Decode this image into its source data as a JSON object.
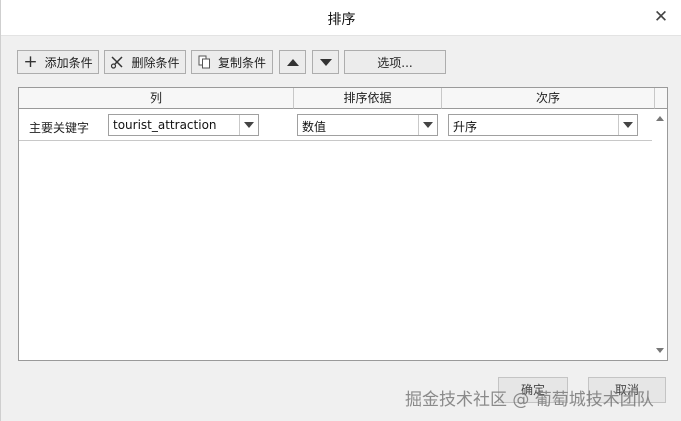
{
  "dialog": {
    "title": "排序",
    "close_glyph": "✕"
  },
  "toolbar": {
    "add_condition": "添加条件",
    "delete_condition": "删除条件",
    "copy_condition": "复制条件",
    "move_up_icon": "triangle-up-icon",
    "move_down_icon": "triangle-down-icon",
    "options": "选项..."
  },
  "grid": {
    "headers": {
      "column": "列",
      "sort_on": "排序依据",
      "order": "次序"
    },
    "rows": [
      {
        "label": "主要关键字",
        "column_value": "tourist_attraction",
        "sort_on_value": "数值",
        "order_value": "升序"
      }
    ]
  },
  "footer": {
    "ok_label": "确定",
    "cancel_label": "取消"
  },
  "watermark": "掘金技术社区 @ 葡萄城技术团队"
}
